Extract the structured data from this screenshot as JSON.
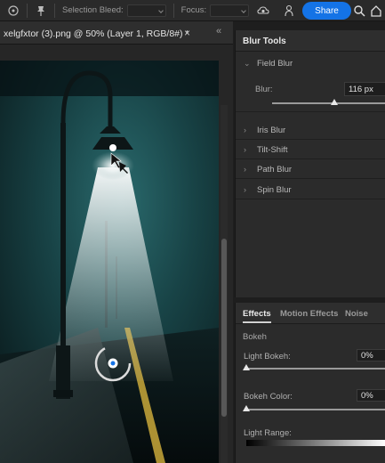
{
  "options_bar": {
    "selection_bleed_label": "Selection Bleed:",
    "focus_label": "Focus:",
    "share_label": "Share"
  },
  "document": {
    "tab_title": "xelgfxtor (3).png @ 50% (Layer 1, RGB/8#) *",
    "close_glyph": "×",
    "collapse_glyph": "«"
  },
  "blur_tools": {
    "title": "Blur Tools",
    "field_blur": {
      "label": "Field Blur",
      "blur_label": "Blur:",
      "blur_value": "116 px",
      "slider_fraction": 0.55
    },
    "collapsed": [
      {
        "label": "Iris Blur"
      },
      {
        "label": "Tilt-Shift"
      },
      {
        "label": "Path Blur"
      },
      {
        "label": "Spin Blur"
      }
    ]
  },
  "effects_panel": {
    "tabs": [
      {
        "label": "Effects",
        "active": true
      },
      {
        "label": "Motion Effects",
        "active": false
      },
      {
        "label": "Noise",
        "active": false
      }
    ],
    "section": "Bokeh",
    "light_bokeh": {
      "label": "Light Bokeh:",
      "value": "0%",
      "fraction": 0.0
    },
    "bokeh_color": {
      "label": "Bokeh Color:",
      "value": "0%",
      "fraction": 0.0
    },
    "light_range": {
      "label": "Light Range:"
    }
  },
  "colors": {
    "accent": "#1473e6",
    "panel_bg": "#2b2b2b",
    "canvas_teal": "#1b4a4e"
  },
  "icons": [
    "blur-tool-icon",
    "pin-icon",
    "cloud-sync-icon",
    "puppet-icon",
    "search-icon",
    "home-icon",
    "chevron-down-icon",
    "chevron-right-icon",
    "blur-pin-icon"
  ]
}
